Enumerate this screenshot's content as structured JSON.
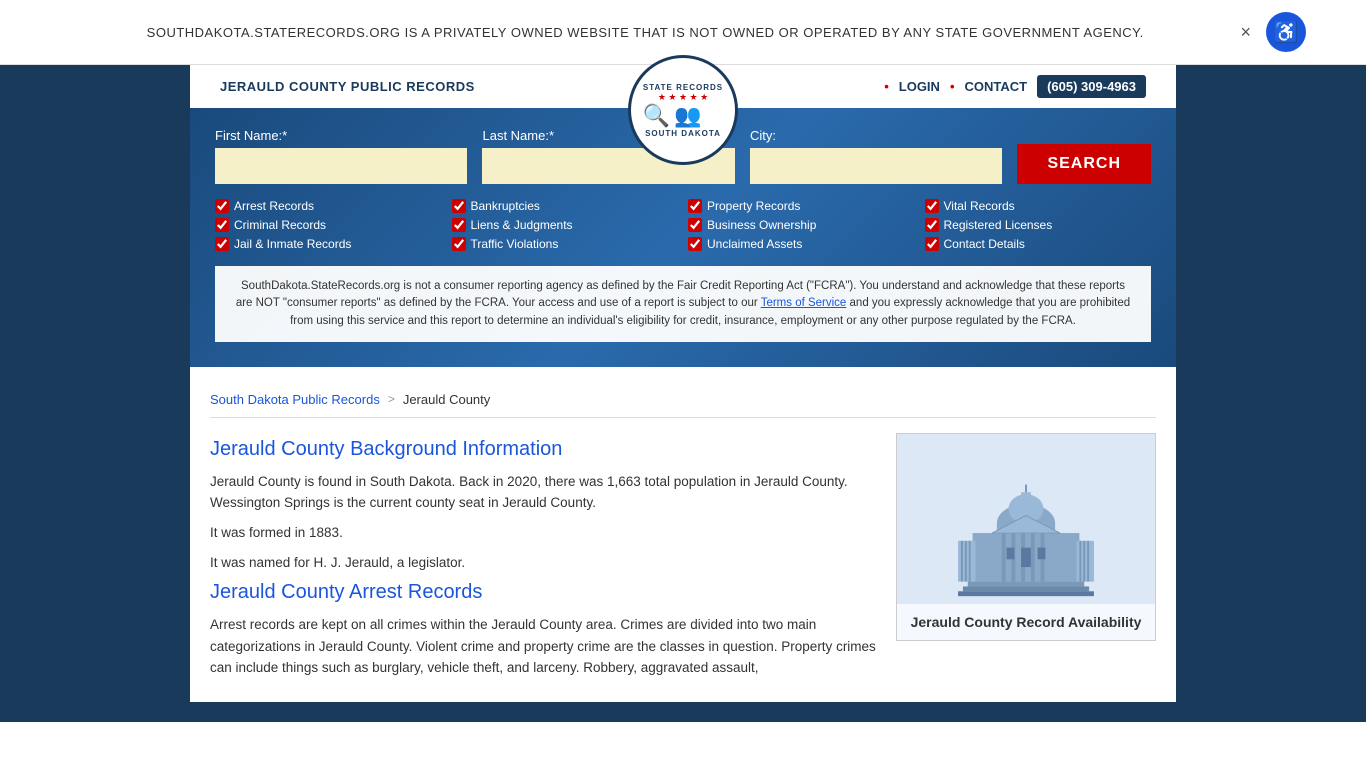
{
  "banner": {
    "text": "SOUTHDAKOTA.STATERECORDS.ORG IS A PRIVATELY OWNED WEBSITE THAT IS NOT OWNED OR OPERATED BY ANY STATE GOVERNMENT AGENCY.",
    "close_label": "×"
  },
  "header": {
    "brand": "JERAULD COUNTY PUBLIC RECORDS",
    "logo": {
      "top": "STATE RECORDS",
      "stars": "★ ★ ★ ★ ★",
      "bottom": "SOUTH DAKOTA"
    },
    "nav": {
      "login": "LOGIN",
      "contact": "CONTACT",
      "phone": "(605) 309-4963"
    }
  },
  "search": {
    "first_name_label": "First Name:*",
    "last_name_label": "Last Name:*",
    "city_label": "City:",
    "first_name_placeholder": "",
    "last_name_placeholder": "",
    "city_placeholder": "",
    "button_label": "SEARCH",
    "checkboxes": [
      {
        "label": "Arrest Records",
        "checked": true
      },
      {
        "label": "Bankruptcies",
        "checked": true
      },
      {
        "label": "Property Records",
        "checked": true
      },
      {
        "label": "Vital Records",
        "checked": true
      },
      {
        "label": "Criminal Records",
        "checked": true
      },
      {
        "label": "Liens & Judgments",
        "checked": true
      },
      {
        "label": "Business Ownership",
        "checked": true
      },
      {
        "label": "Registered Licenses",
        "checked": true
      },
      {
        "label": "Jail & Inmate Records",
        "checked": true
      },
      {
        "label": "Traffic Violations",
        "checked": true
      },
      {
        "label": "Unclaimed Assets",
        "checked": true
      },
      {
        "label": "Contact Details",
        "checked": true
      }
    ],
    "disclaimer": "SouthDakota.StateRecords.org is not a consumer reporting agency as defined by the Fair Credit Reporting Act (\"FCRA\"). You understand and acknowledge that these reports are NOT \"consumer reports\" as defined by the FCRA. Your access and use of a report is subject to our Terms of Service and you expressly acknowledge that you are prohibited from using this service and this report to determine an individual's eligibility for credit, insurance, employment or any other purpose regulated by the FCRA.",
    "disclaimer_link": "Terms of Service"
  },
  "breadcrumb": {
    "link_text": "South Dakota Public Records",
    "separator": ">",
    "current": "Jerauld County"
  },
  "main_content": {
    "section1_title": "Jerauld County Background Information",
    "section1_para1": "Jerauld County is found in South Dakota. Back in 2020, there was 1,663 total population in Jerauld County. Wessington Springs is the current county seat in Jerauld County.",
    "section1_para2": "It was formed in 1883.",
    "section1_para3": "It was named for H. J. Jerauld, a legislator.",
    "section2_title": "Jerauld County Arrest Records",
    "section2_para1": "Arrest records are kept on all crimes within the Jerauld County area. Crimes are divided into two main categorizations in Jerauld County. Violent crime and property crime are the classes in question. Property crimes can include things such as burglary, vehicle theft, and larceny. Robbery, aggravated assault,"
  },
  "sidebar": {
    "card_title": "Jerauld County Record Availability"
  }
}
